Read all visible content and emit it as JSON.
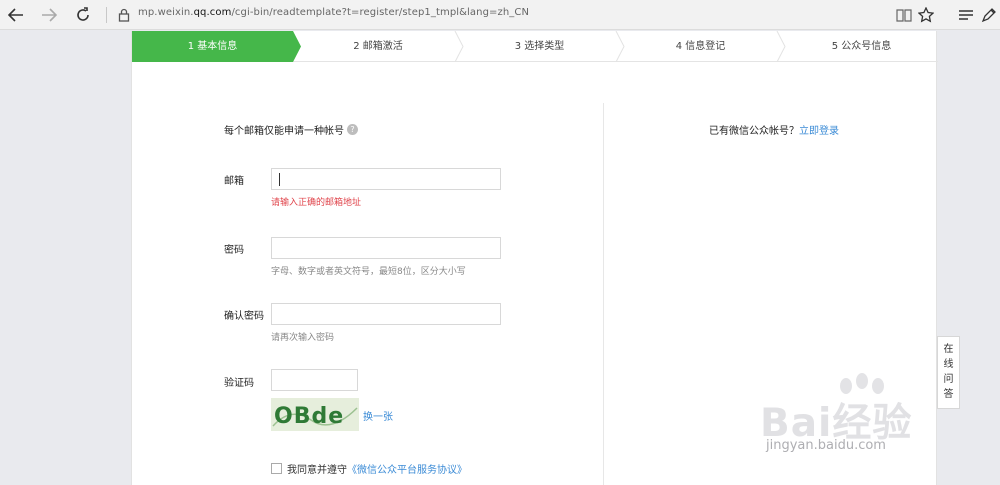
{
  "browser": {
    "url_prefix": "mp.weixin.",
    "url_domain": "qq.com",
    "url_path": "/cgi-bin/readtemplate?t=register/step1_tmpl&lang=zh_CN"
  },
  "steps": [
    {
      "label": "1 基本信息",
      "active": true
    },
    {
      "label": "2 邮箱激活",
      "active": false
    },
    {
      "label": "3 选择类型",
      "active": false
    },
    {
      "label": "4 信息登记",
      "active": false
    },
    {
      "label": "5 公众号信息",
      "active": false
    }
  ],
  "colors": {
    "accent": "#45b74a",
    "link": "#3b8bd6",
    "error": "#e0444b"
  },
  "form": {
    "title": "每个邮箱仅能申请一种帐号",
    "help_icon": "?",
    "email_label": "邮箱",
    "email_error": "请输入正确的邮箱地址",
    "password_label": "密码",
    "password_hint": "字母、数字或者英文符号，最短8位，区分大小写",
    "confirm_label": "确认密码",
    "confirm_hint": "请再次输入密码",
    "captcha_label": "验证码",
    "captcha_text": "OBde",
    "refresh_label": "换一张",
    "agree_prefix": "我同意并遵守",
    "agree_link": "《微信公众平台服务协议》"
  },
  "login": {
    "prompt": "已有微信公众帐号？",
    "link": "立即登录"
  },
  "online_help": [
    "在",
    "线",
    "问",
    "答"
  ],
  "watermark": {
    "text": "Bai经验",
    "url": "jingyan.baidu.com"
  }
}
